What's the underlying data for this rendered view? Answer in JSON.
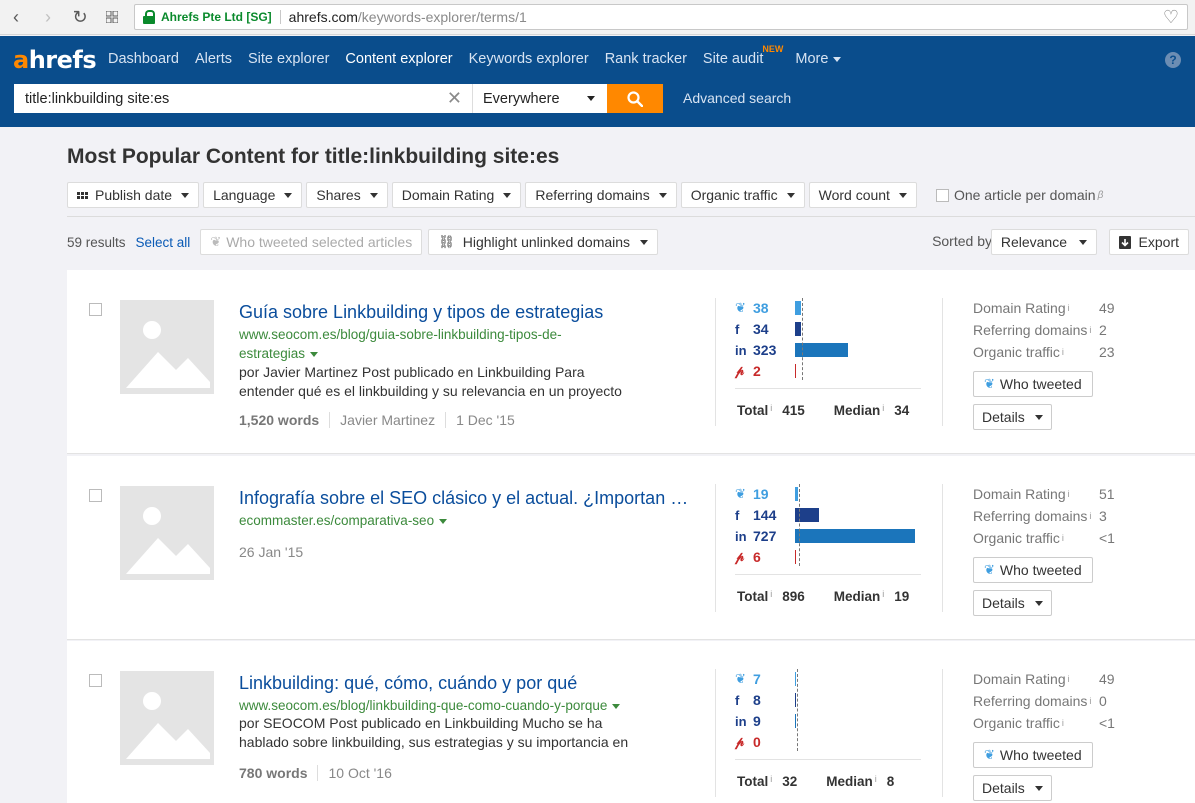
{
  "browser": {
    "cert": "Ahrefs Pte Ltd [SG]",
    "url_host": "ahrefs.com",
    "url_path": "/keywords-explorer/terms/1"
  },
  "header": {
    "logo_a": "a",
    "logo_rest": "hrefs",
    "nav": [
      "Dashboard",
      "Alerts",
      "Site explorer",
      "Content explorer",
      "Keywords explorer",
      "Rank tracker",
      "Site audit",
      "More"
    ],
    "new_badge": "NEW",
    "help": "?"
  },
  "search": {
    "query": "title:linkbuilding site:es",
    "scope": "Everywhere",
    "advanced": "Advanced search"
  },
  "page": {
    "title": "Most Popular Content for title:linkbuilding site:es"
  },
  "filters": {
    "publish_date": "Publish date",
    "language": "Language",
    "shares": "Shares",
    "domain_rating": "Domain Rating",
    "referring_domains": "Referring domains",
    "organic_traffic": "Organic traffic",
    "word_count": "Word count",
    "one_article": "One article per domain",
    "beta": "β"
  },
  "toolbar": {
    "results": "59 results",
    "select_all": "Select all",
    "who_tweeted_selected": "Who tweeted selected articles",
    "highlight": "Highlight unlinked domains",
    "sorted_by": "Sorted by",
    "sort_value": "Relevance",
    "export": "Export"
  },
  "labels": {
    "total": "Total",
    "median": "Median",
    "info": "i",
    "domain_rating": "Domain Rating",
    "referring_domains": "Referring domains",
    "organic_traffic": "Organic traffic",
    "who_tweeted": "Who tweeted",
    "details": "Details",
    "tw": "🐦",
    "fb": "f",
    "li": "in",
    "pi": "℗"
  },
  "results": [
    {
      "title": "Guía sobre Linkbuilding y tipos de estrategias",
      "url": "www.seocom.es/blog/guia-sobre-linkbuilding-tipos-de-estrategias",
      "desc": "por Javier Martinez Post publicado en Linkbuilding Para entender qué es el linkbuilding y su relevancia en un proyecto",
      "words": "1,520 words",
      "author": "Javier Martinez",
      "date": "1 Dec '15",
      "twitter": 38,
      "facebook": 34,
      "linkedin": 323,
      "pinterest": 2,
      "total": "415",
      "median": "34",
      "domain_rating": "49",
      "referring_domains": "2",
      "organic_traffic": "23"
    },
    {
      "title": "Infografía sobre el SEO clásico y el actual. ¿Importan …",
      "url": "ecommaster.es/comparativa-seo",
      "desc": "",
      "words": "",
      "author": "",
      "date": "26 Jan '15",
      "twitter": 19,
      "facebook": 144,
      "linkedin": 727,
      "pinterest": 6,
      "total": "896",
      "median": "19",
      "domain_rating": "51",
      "referring_domains": "3",
      "organic_traffic": "<1"
    },
    {
      "title": "Linkbuilding: qué, cómo, cuándo y por qué",
      "url": "www.seocom.es/blog/linkbuilding-que-como-cuando-y-porque",
      "desc": "por SEOCOM Post publicado en Linkbuilding Mucho se ha hablado sobre linkbuilding, sus estrategias y su importancia en",
      "words": "780 words",
      "author": "",
      "date": "10 Oct '16",
      "twitter": 7,
      "facebook": 8,
      "linkedin": 9,
      "pinterest": 0,
      "total": "32",
      "median": "8",
      "domain_rating": "49",
      "referring_domains": "0",
      "organic_traffic": "<1"
    }
  ],
  "colors": {
    "header": "#0a4d8c",
    "accent": "#ff8800",
    "link": "#0a4d9c",
    "url": "#3c8a3c",
    "twitter": "#3f9ee0",
    "facebook_linkedin": "#1d3f8a",
    "linkedin_bar": "#1b75bb",
    "pinterest": "#c82a2a"
  }
}
